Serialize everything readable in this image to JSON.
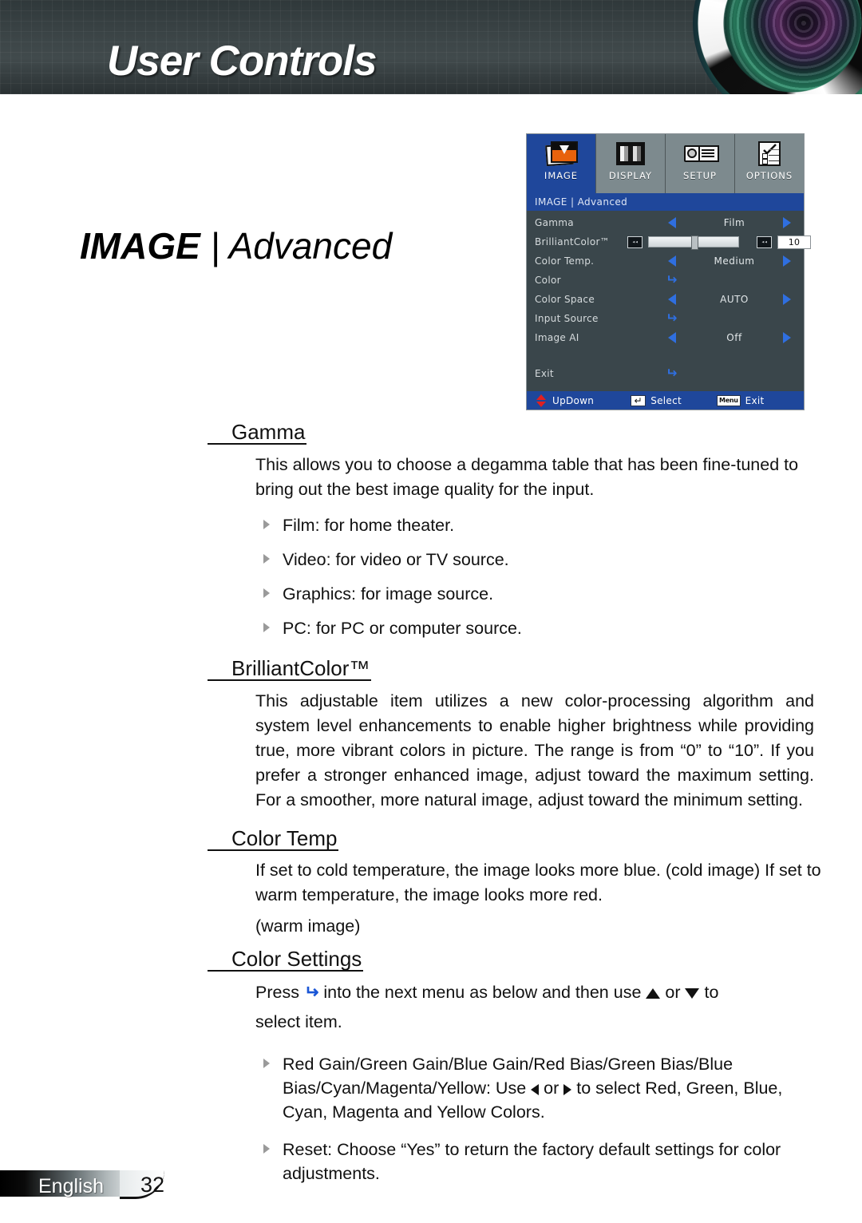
{
  "header": {
    "title": "User Controls",
    "lens_icon": "camera-lens-icon"
  },
  "page_title": {
    "strong": "IMAGE",
    "rest": " | Advanced"
  },
  "osd": {
    "tabs": [
      {
        "label": "IMAGE",
        "icon": "image-photo-icon",
        "active": true
      },
      {
        "label": "DISPLAY",
        "icon": "display-grayscale-icon",
        "active": false
      },
      {
        "label": "SETUP",
        "icon": "projector-icon",
        "active": false
      },
      {
        "label": "OPTIONS",
        "icon": "checklist-icon",
        "active": false
      }
    ],
    "breadcrumb": "IMAGE  |  Advanced",
    "rows": [
      {
        "label": "Gamma",
        "type": "arrows",
        "value": "Film"
      },
      {
        "label": "BrilliantColor™",
        "type": "slider",
        "value": "10",
        "slider_percent": 50,
        "left_icon": "minus-key-icon",
        "right_icon": "plus-key-icon"
      },
      {
        "label": "Color Temp.",
        "type": "arrows",
        "value": "Medium"
      },
      {
        "label": "Color",
        "type": "enter",
        "value": ""
      },
      {
        "label": "Color Space",
        "type": "arrows",
        "value": "AUTO"
      },
      {
        "label": "Input Source",
        "type": "enter",
        "value": ""
      },
      {
        "label": "Image AI",
        "type": "arrows",
        "value": "Off"
      },
      {
        "label": "",
        "type": "gap",
        "value": ""
      },
      {
        "label": "Exit",
        "type": "enter",
        "value": ""
      }
    ],
    "status": [
      {
        "key_icon": "up-down-arrows-icon",
        "key_text": "",
        "label": "UpDown"
      },
      {
        "key_icon": "enter-key-icon",
        "key_text": "↵",
        "label": "Select"
      },
      {
        "key_icon": "menu-key-icon",
        "key_text": "Menu",
        "label": "Exit"
      }
    ]
  },
  "sections": [
    {
      "heading": "Gamma",
      "paragraphs": [
        "This allows you to choose a degamma table that has been fine-tuned to bring out the best image quality for the input."
      ],
      "bullets": [
        "Film: for home theater.",
        "Video: for video or TV source.",
        "Graphics: for image source.",
        "PC: for PC or computer source."
      ]
    },
    {
      "heading": "BrilliantColor™",
      "paragraphs": [
        "This adjustable item utilizes a new color-processing algorithm and system level enhancements to enable higher brightness while providing true, more vibrant colors in picture. The range is from “0” to “10”. If you prefer a stronger enhanced image, adjust toward the maximum setting. For a smoother, more natural image, adjust toward the minimum setting."
      ],
      "bullets": []
    },
    {
      "heading": "Color Temp",
      "paragraphs": [
        "If set to cold temperature, the image looks more blue. (cold image) If set to warm temperature, the image looks more red.",
        "(warm image)"
      ],
      "bullets": []
    },
    {
      "heading": "Color Settings",
      "press_line": {
        "before": "Press",
        "enter_icon": "enter-key-icon",
        "middle": "into the next menu as below and then use",
        "up_icon": "up-triangle-icon",
        "or": "or",
        "down_icon": "down-triangle-icon",
        "after": "to"
      },
      "press_line_2": "select item.",
      "bullets": []
    }
  ],
  "color_bullets": [
    {
      "part1": "Red Gain/Green Gain/Blue Gain/Red Bias/Green Bias/Blue Bias/Cyan/Magenta/Yellow: Use",
      "left_icon": "left-triangle-icon",
      "or": "or",
      "right_icon": "right-triangle-icon",
      "part2": "to select Red, Green, Blue, Cyan, Magenta and Yellow Colors."
    },
    {
      "text": "Reset: Choose “Yes” to return the factory default settings for color adjustments."
    }
  ],
  "footer": {
    "language": "English",
    "page": "32"
  },
  "colors": {
    "accent_blue": "#1f479b",
    "arrow_blue": "#2f6fe0",
    "osd_body": "#3a464b",
    "osd_tab_inactive": "#7d8a8e",
    "status_red": "#e02020"
  }
}
